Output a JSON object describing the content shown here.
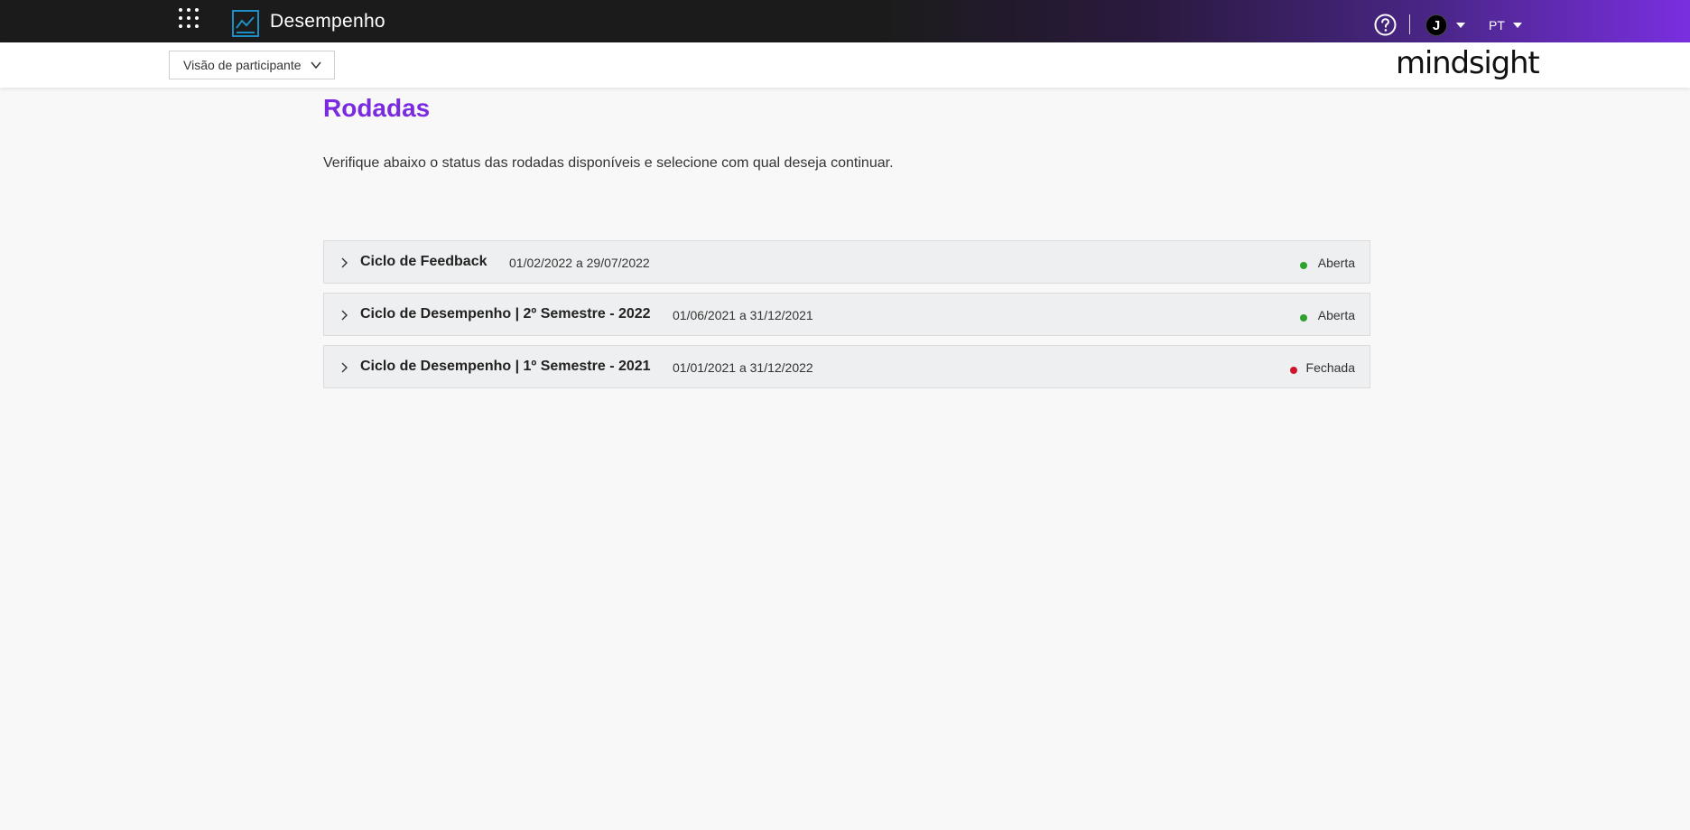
{
  "topbar": {
    "app_title": "Desempenho",
    "user_initial": "J",
    "language": "PT"
  },
  "subbar": {
    "view_label": "Visão de participante",
    "brand": "mindsight"
  },
  "main": {
    "title": "Rodadas",
    "description": "Verifique abaixo o status das rodadas disponíveis e selecione com qual deseja continuar."
  },
  "rounds": [
    {
      "name": "Ciclo de Feedback",
      "dates": "01/02/2022 a 29/07/2022",
      "status": "Aberta",
      "status_color": "#2ea12e"
    },
    {
      "name": "Ciclo de Desempenho | 2º Semestre - 2022",
      "dates": "01/06/2021 a 31/12/2021",
      "status": "Aberta",
      "status_color": "#2ea12e"
    },
    {
      "name": "Ciclo de Desempenho | 1º Semestre - 2021",
      "dates": "01/01/2021 a 31/12/2022",
      "status": "Fechada",
      "status_color": "#d0142c"
    }
  ],
  "colors": {
    "accent": "#7a2be0",
    "open": "#2ea12e",
    "closed": "#d0142c"
  },
  "icons": [
    "apps-grid-icon",
    "performance-chart-icon",
    "help-icon",
    "caret-down-icon",
    "chevron-down-icon",
    "chevron-right-icon"
  ]
}
